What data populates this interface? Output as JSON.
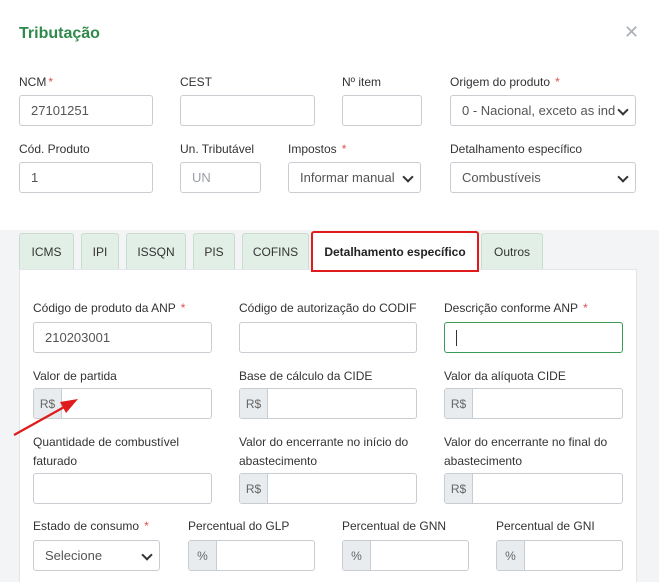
{
  "dialog": {
    "title": "Tributação"
  },
  "row1": {
    "ncm": {
      "label": "NCM",
      "required": "*",
      "value": "27101251"
    },
    "cest": {
      "label": "CEST",
      "value": ""
    },
    "nitem": {
      "label": "Nº item",
      "value": ""
    },
    "origem": {
      "label": "Origem do produto",
      "required": "*",
      "value": "0 - Nacional, exceto as ind"
    }
  },
  "row2": {
    "cod_produto": {
      "label": "Cód. Produto",
      "value": "1"
    },
    "un_tributavel": {
      "label": "Un. Tributável",
      "placeholder": "UN"
    },
    "impostos": {
      "label": "Impostos",
      "required": "*",
      "value": "Informar manual"
    },
    "detalhamento": {
      "label": "Detalhamento específico",
      "value": "Combustíveis"
    }
  },
  "tabs": [
    "ICMS",
    "IPI",
    "ISSQN",
    "PIS",
    "COFINS",
    "Detalhamento específico",
    "Outros"
  ],
  "active_tab": "Detalhamento específico",
  "form": {
    "cod_anp": {
      "label": "Código de produto da ANP",
      "required": "*",
      "value": "210203001"
    },
    "codif": {
      "label": "Código de autorização do CODIF",
      "value": ""
    },
    "desc_anp": {
      "label": "Descrição conforme ANP",
      "required": "*",
      "value": ""
    },
    "valor_partida": {
      "label": "Valor de partida",
      "addon": "R$",
      "value": ""
    },
    "base_cide": {
      "label": "Base de cálculo da CIDE",
      "addon": "R$",
      "value": ""
    },
    "aliquota_cide": {
      "label": "Valor da alíquota CIDE",
      "addon": "R$",
      "value": ""
    },
    "qtd_comb": {
      "label_line1": "Quantidade de combustível",
      "label_line2": "faturado",
      "value": ""
    },
    "enc_inicio": {
      "label_line1": "Valor do encerrante no início do",
      "label_line2": "abastecimento",
      "addon": "R$",
      "value": ""
    },
    "enc_final": {
      "label_line1": "Valor do encerrante no final do",
      "label_line2": "abastecimento",
      "addon": "R$",
      "value": ""
    },
    "estado_consumo": {
      "label": "Estado de consumo",
      "required": "*",
      "value": "Selecione"
    },
    "perc_glp": {
      "label": "Percentual do GLP",
      "addon": "%",
      "value": ""
    },
    "perc_gnn": {
      "label": "Percentual de GNN",
      "addon": "%",
      "value": ""
    },
    "perc_gni": {
      "label": "Percentual de GNI",
      "addon": "%",
      "value": ""
    }
  },
  "colors": {
    "title_green": "#2f8a4c",
    "highlight_red": "#e01b1b",
    "tab_bg": "#e2efe6"
  }
}
